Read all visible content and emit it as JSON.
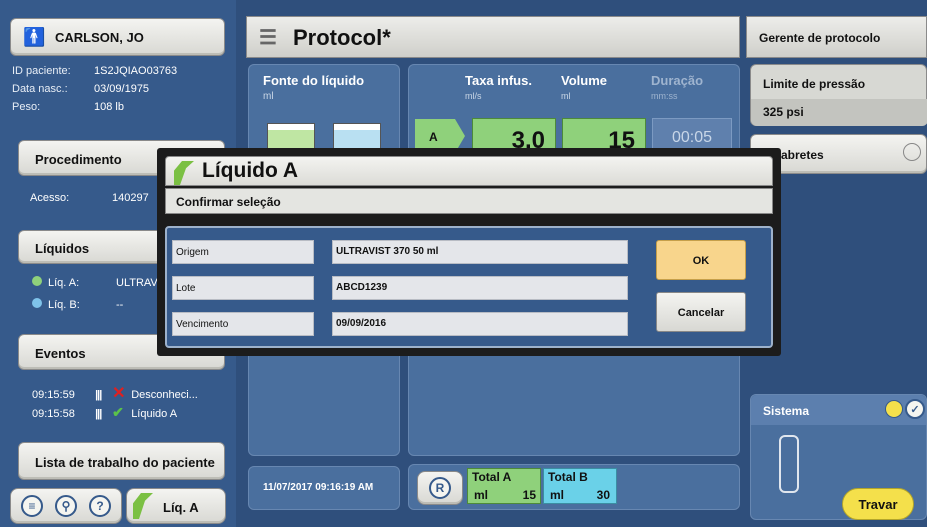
{
  "patient": {
    "name": "CARLSON, JO",
    "id_label": "ID paciente:",
    "id_value": "1S2JQIAO03763",
    "dob_label": "Data nasc.:",
    "dob_value": "03/09/1975",
    "weight_label": "Peso:",
    "weight_value": "108 lb"
  },
  "procedure": {
    "title": "Procedimento",
    "access_label": "Acesso:",
    "access_value": "140297"
  },
  "liquids": {
    "title": "Líquidos",
    "a_label": "Líq. A:",
    "a_value": "ULTRAV",
    "b_label": "Líq. B:",
    "b_value": "--"
  },
  "events": {
    "title": "Eventos",
    "items": [
      {
        "time": "09:15:59",
        "text": "Desconheci..."
      },
      {
        "time": "09:15:58",
        "text": "Líquido A"
      }
    ]
  },
  "worklist_label": "Lista de trabalho do paciente",
  "bottom_liq_label": "Líq. A",
  "protocol": {
    "title": "Protocol*",
    "fluid_source": "Fonte do líquido",
    "fluid_unit": "ml",
    "rate_label": "Taxa infus.",
    "rate_unit": "ml/s",
    "volume_label": "Volume",
    "volume_unit": "ml",
    "duration_label": "Duração",
    "duration_unit": "mm:ss",
    "phase_label": "A",
    "rate_value": "3.0",
    "volume_value": "15",
    "duration_value": "00:05"
  },
  "datetime": "11/07/2017 09:16:19 AM",
  "totals": {
    "r_label": "R",
    "a_label": "Total A",
    "a_unit": "ml",
    "a_value": "15",
    "b_label": "Total B",
    "b_unit": "ml",
    "b_value": "30"
  },
  "right": {
    "manager": "Gerente de protocolo",
    "pressure_label": "Limite de pressão",
    "pressure_value": "325 psi",
    "caps_label": "abretes",
    "system_label": "Sistema",
    "lock_label": "Travar"
  },
  "dialog": {
    "title": "Líquido A",
    "subtitle": "Confirmar seleção",
    "origin_label": "Origem",
    "origin_value": "ULTRAVIST 370 50 ml",
    "lot_label": "Lote",
    "lot_value": "ABCD1239",
    "expiry_label": "Vencimento",
    "expiry_value": "09/09/2016",
    "ok_label": "OK",
    "cancel_label": "Cancelar"
  },
  "colors": {
    "background": "#2f4f7c",
    "green_value": "#8fd17b",
    "ok_button": "#f8d58c",
    "lock_button": "#f4e04b",
    "total_b": "#6ad1e8"
  }
}
